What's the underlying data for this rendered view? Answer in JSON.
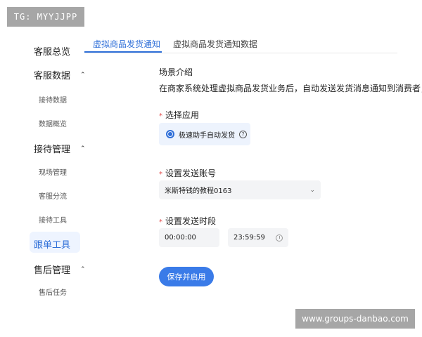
{
  "watermarks": {
    "top": "TG: MYYJJPP",
    "bottom": "www.groups-danbao.com"
  },
  "sidebar": {
    "items": [
      {
        "label": "客服总览"
      },
      {
        "label": "客服数据",
        "expanded": true,
        "children": [
          "接待数据",
          "数据概览"
        ]
      },
      {
        "label": "接待管理",
        "expanded": true,
        "children": [
          "现场管理",
          "客服分流",
          "接待工具"
        ]
      },
      {
        "label": "跟单工具",
        "active": true
      },
      {
        "label": "售后管理",
        "expanded": true,
        "children": [
          "售后任务"
        ]
      }
    ]
  },
  "tabs": [
    {
      "label": "虚拟商品发货通知",
      "active": true
    },
    {
      "label": "虚拟商品发货通知数据",
      "active": false
    }
  ],
  "form": {
    "scene_title": "场景介绍",
    "scene_desc": "在商家系统处理虚拟商品发货业务后，自动发送发货消息通知到消费者，",
    "required_mark": "*",
    "app_label": "选择应用",
    "app_option": "极速助手自动发货",
    "help_icon_glyph": "?",
    "account_label": "设置发送账号",
    "account_value": "米斯特钱的教程0163",
    "time_label": "设置发送时段",
    "time_start": "00:00:00",
    "time_end": "23:59:59",
    "save_button": "保存并启用"
  },
  "icons": {
    "chevron_up": "⌃",
    "chevron_down": "⌄"
  },
  "colors": {
    "accent": "#2f6fd8",
    "button": "#3a7be8",
    "required": "#e24b4b"
  }
}
